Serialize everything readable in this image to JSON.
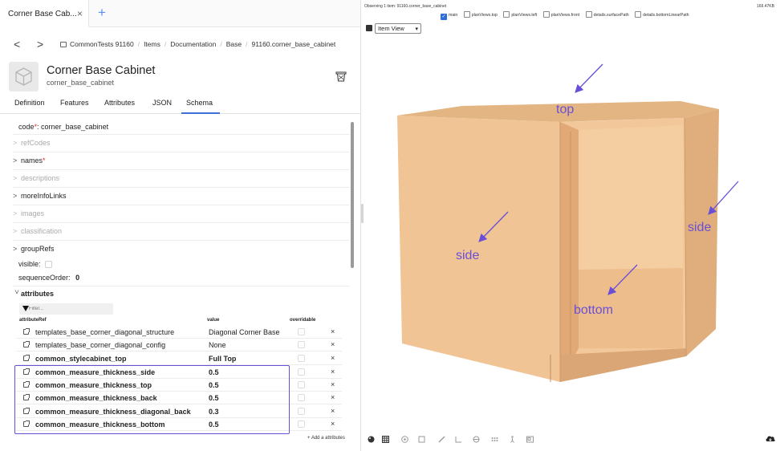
{
  "browser_tab": {
    "title": "Corner Base Cab...",
    "close": "×",
    "new_tab": "+"
  },
  "nav": {
    "back": "<",
    "forward": ">",
    "breadcrumbs": [
      "CommonTests 91160",
      "Items",
      "Documentation",
      "Base",
      "91160.corner_base_cabinet"
    ]
  },
  "item": {
    "title": "Corner Base Cabinet",
    "subtitle": "corner_base_cabinet"
  },
  "tabs": [
    "Definition",
    "Features",
    "Attributes",
    "JSON",
    "Schema"
  ],
  "active_tab": "Schema",
  "schema": {
    "code_label": "code",
    "code_req": "*",
    "code_value": ": corner_base_cabinet",
    "refCodes": "refCodes",
    "names": "names",
    "names_req": "*",
    "descriptions": "descriptions",
    "moreInfoLinks": "moreInfoLinks",
    "images": "images",
    "classification": "classification",
    "groupRefs": "groupRefs",
    "visible": "visible:",
    "sequenceOrder_label": "sequenceOrder:",
    "sequenceOrder_value": "0",
    "attributes": "attributes"
  },
  "filter": {
    "placeholder": "Filter..."
  },
  "columns": {
    "ref": "attributeRef",
    "value": "value",
    "overridable": "overridable"
  },
  "attribute_rows": [
    {
      "name": "templates_base_corner_diagonal_structure",
      "value": "Diagonal Corner Base",
      "bold": false
    },
    {
      "name": "templates_base_corner_diagonal_config",
      "value": "None",
      "bold": false
    },
    {
      "name": "common_stylecabinet_top",
      "value": "Full Top",
      "bold": true
    },
    {
      "name": "common_measure_thickness_side",
      "value": "0.5",
      "bold": true
    },
    {
      "name": "common_measure_thickness_top",
      "value": "0.5",
      "bold": true
    },
    {
      "name": "common_measure_thickness_back",
      "value": "0.5",
      "bold": true
    },
    {
      "name": "common_measure_thickness_diagonal_back",
      "value": "0.3",
      "bold": true
    },
    {
      "name": "common_measure_thickness_bottom",
      "value": "0.5",
      "bold": true
    }
  ],
  "remove_symbol": "×",
  "add_attributes": "+ Add a attributes",
  "viewer": {
    "observing": "Observing 1 item: 91160.corner_base_cabinet",
    "size": "169.47KB",
    "views": [
      {
        "label": "main",
        "checked": true
      },
      {
        "label": "planViews.top",
        "checked": false
      },
      {
        "label": "planViews.left",
        "checked": false
      },
      {
        "label": "planViews.front",
        "checked": false
      },
      {
        "label": "details.surfacePath",
        "checked": false
      },
      {
        "label": "details.bottomLinearPath",
        "checked": false
      }
    ],
    "view_mode": "Item View",
    "annotations": {
      "top": "top",
      "side_left": "side",
      "side_right": "side",
      "bottom": "bottom"
    },
    "annotation_color": "#6a4fd6",
    "wood_color": "#e7b98a"
  },
  "icons": {
    "trash": "trash-icon",
    "toolbar": [
      "palette-icon",
      "grid-icon",
      "compass-icon",
      "cube-icon",
      "brush-icon",
      "ruler-icon",
      "target-icon",
      "dots-icon",
      "walk-icon",
      "image-icon",
      "cloud-download-icon"
    ]
  }
}
